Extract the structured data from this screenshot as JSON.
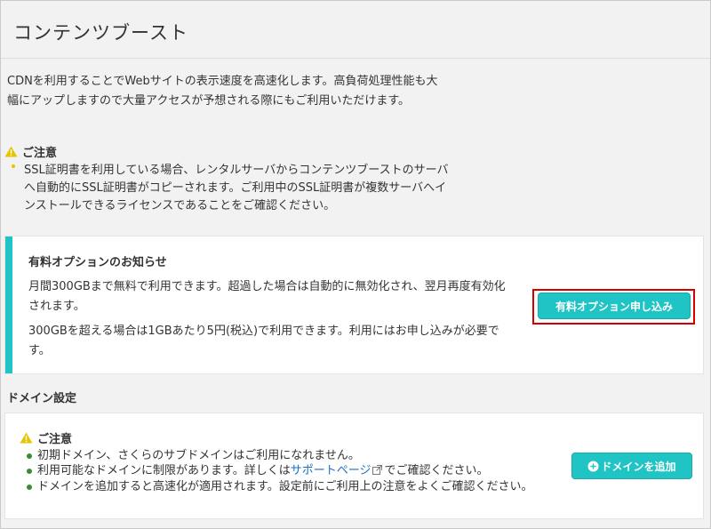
{
  "page": {
    "title": "コンテンツブースト",
    "intro": "CDNを利用することでWebサイトの表示速度を高速化します。高負荷処理性能も大幅にアップしますので大量アクセスが予想される際にもご利用いただけます。"
  },
  "notice1": {
    "heading": "ご注意",
    "items": [
      "SSL証明書を利用している場合、レンタルサーバからコンテンツブーストのサーバへ自動的にSSL証明書がコピーされます。ご利用中のSSL証明書が複数サーバへインストールできるライセンスであることをご確認ください。"
    ]
  },
  "paid_option": {
    "title": "有料オプションのお知らせ",
    "paragraph1": "月間300GBまで無料で利用できます。超過した場合は自動的に無効化され、翌月再度有効化されます。",
    "paragraph2": "300GBを超える場合は1GBあたり5円(税込)で利用できます。利用にはお申し込みが必要です。",
    "button_label": "有料オプション申し込み"
  },
  "domain_settings": {
    "heading": "ドメイン設定",
    "notice_heading": "ご注意",
    "item1": "初期ドメイン、さくらのサブドメインはご利用になれません。",
    "item2_before": "利用可能なドメインに制限があります。詳しくは",
    "item2_link": "サポートページ",
    "item2_after": "でご確認ください。",
    "item3": "ドメインを追加すると高速化が適用されます。設定前にご利用上の注意をよくご確認ください。",
    "add_button_label": "ドメインを追加"
  },
  "colors": {
    "accent": "#21c4c4",
    "highlight": "#d40000",
    "link": "#1a6fc4",
    "warning": "#e8c300"
  }
}
